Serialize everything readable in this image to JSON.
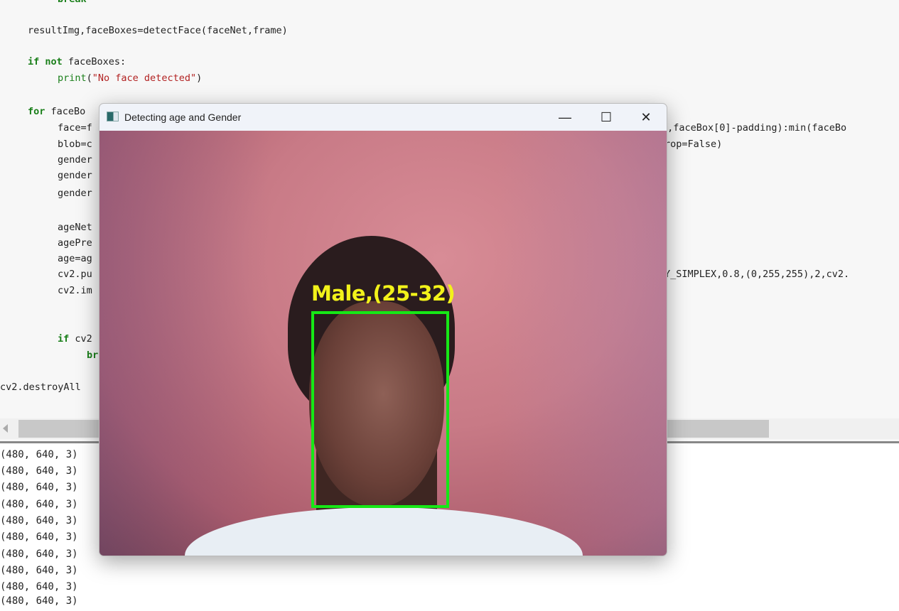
{
  "editor": {
    "lines": [
      {
        "id": "break-top",
        "text": "break"
      },
      {
        "id": "resultimg",
        "text": "resultImg,faceBoxes=detectFace(faceNet,frame)"
      },
      {
        "id": "if-not",
        "kw": "if not",
        "text": " faceBoxes:"
      },
      {
        "id": "print",
        "fn": "print",
        "text": "(",
        "str": "\"No face detected\"",
        "tail": ")"
      },
      {
        "id": "for",
        "kw": "for",
        "text": " faceBo"
      },
      {
        "id": "face",
        "text": "face=f",
        "right": "),faceBox[0]-padding):min(faceBo"
      },
      {
        "id": "blob",
        "text": "blob=c",
        "right": "rop=False)"
      },
      {
        "id": "gender1",
        "text": "gender"
      },
      {
        "id": "gender2",
        "text": "gender"
      },
      {
        "id": "gender3",
        "text": "gender"
      },
      {
        "id": "agenet",
        "text": "ageNet"
      },
      {
        "id": "agepre",
        "text": "agePre"
      },
      {
        "id": "age",
        "text": "age=ag"
      },
      {
        "id": "puttext",
        "text": "cv2.pu",
        "right": "Y_SIMPLEX,0.8,(0,255,255),2,cv2."
      },
      {
        "id": "imshow",
        "text": "cv2.im"
      },
      {
        "id": "if-cv2",
        "kw": "if",
        "text": " cv2"
      },
      {
        "id": "break",
        "kw": "br"
      },
      {
        "id": "destroy",
        "text": "cv2.destroyAll"
      }
    ]
  },
  "output": {
    "lines": [
      "(480, 640, 3)",
      "(480, 640, 3)",
      "(480, 640, 3)",
      "(480, 640, 3)",
      "(480, 640, 3)",
      "(480, 640, 3)",
      "(480, 640, 3)",
      "(480, 640, 3)",
      "(480, 640, 3)",
      "(480, 640, 3)"
    ]
  },
  "window": {
    "title": "Detecting age and Gender",
    "minimize": "—",
    "maximize": "☐",
    "close": "✕",
    "detection_label": "Male,(25-32)",
    "box_color": "#16e816",
    "label_color": "#f2f21a"
  }
}
